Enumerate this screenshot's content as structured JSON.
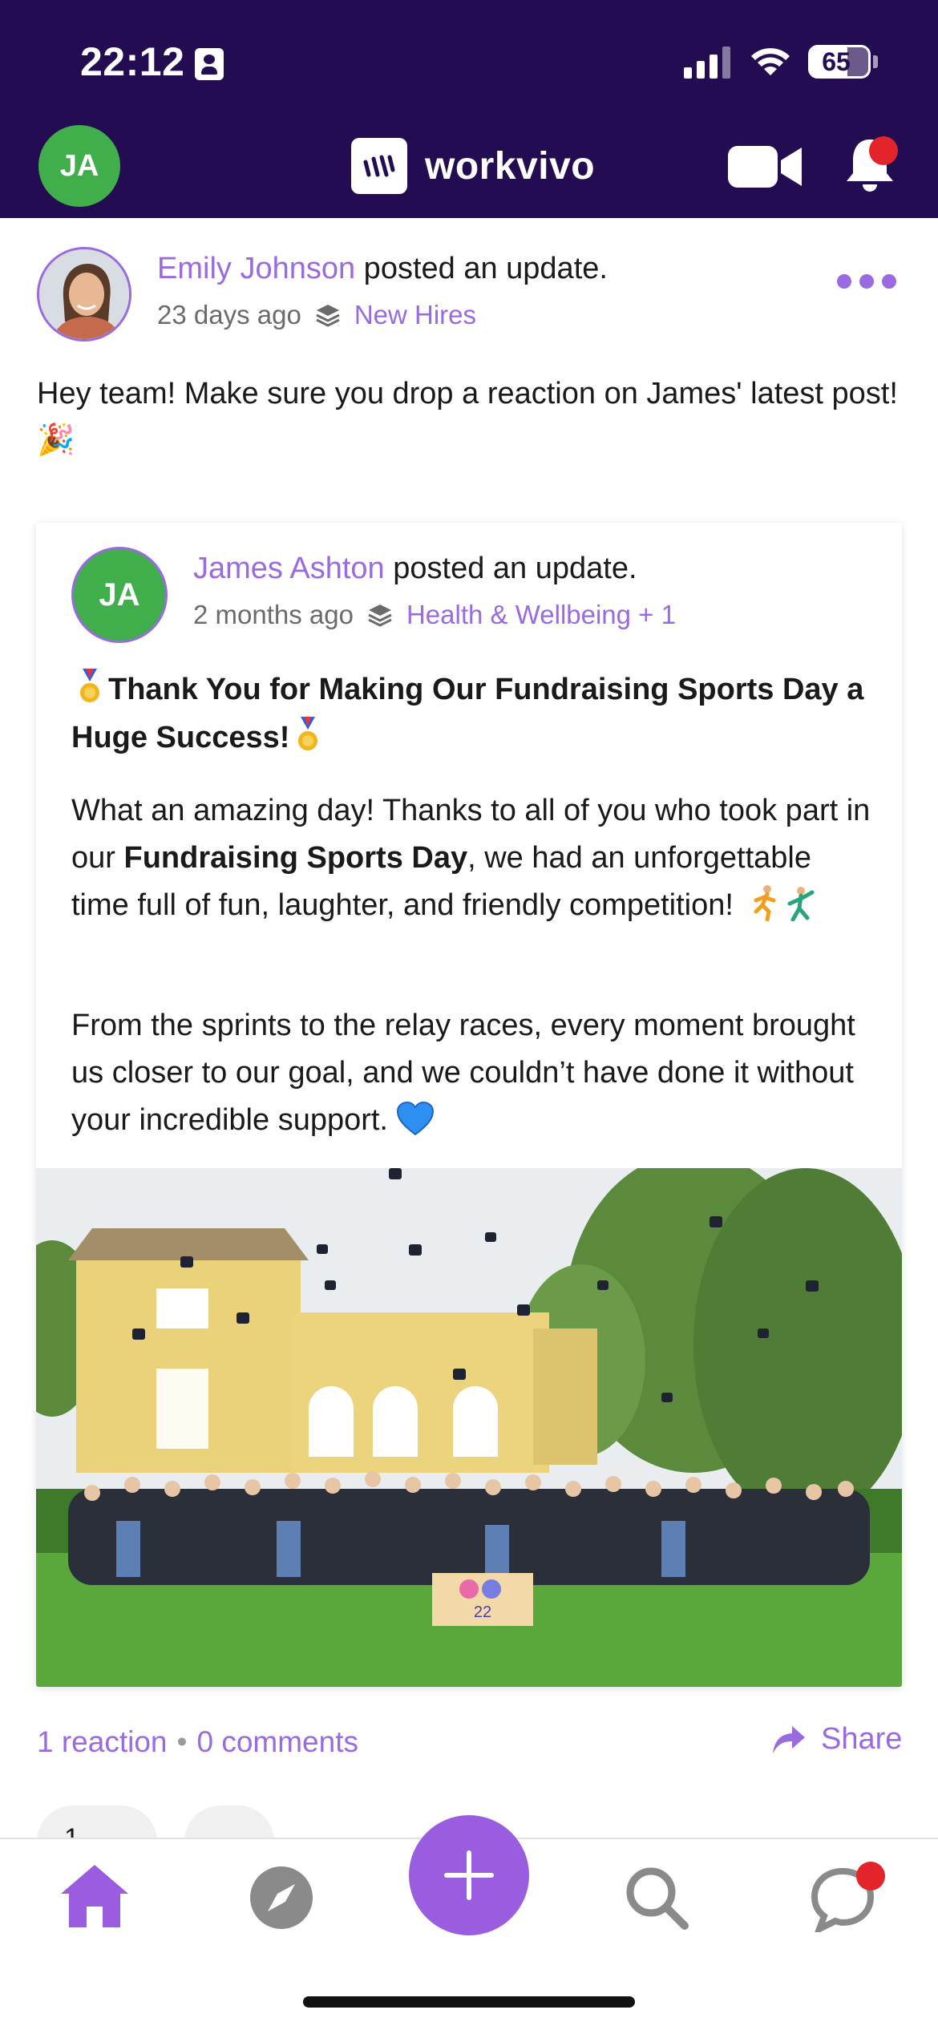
{
  "status_bar": {
    "time": "22:12",
    "battery": "65"
  },
  "header": {
    "user_initials": "JA",
    "brand_name": "workvivo",
    "icons": [
      "video-icon",
      "bell-icon"
    ]
  },
  "post": {
    "author": "Emily Johnson",
    "action": " posted an update.",
    "time_ago": "23 days ago",
    "group": "New Hires",
    "text": "Hey team! Make sure you drop a reaction on James' latest post! 🎉"
  },
  "shared_post": {
    "avatar_initials": "JA",
    "author": "James Ashton",
    "action": " posted an update.",
    "time_ago": "2 months ago",
    "group": "Health & Wellbeing + 1",
    "title": "Thank You for Making Our Fundraising Sports Day a Huge Success!",
    "para1_a": "What an amazing day! Thanks to all of you who took part in our ",
    "para1_bold": "Fundraising Sports Day",
    "para1_b": ", we had an unforgettable time full of fun, laughter, and friendly competition!",
    "para2": "From the sprints to the relay races, every moment brought us closer to our goal, and we couldn’t have done it without your incredible support.",
    "photo_banner": "22"
  },
  "footer": {
    "reactions": "1 reaction",
    "separator": "•",
    "comments": "0 comments",
    "share": "Share",
    "reaction_count": "1"
  },
  "nav": {
    "items": [
      "home-icon",
      "compass-icon",
      "plus-icon",
      "search-icon",
      "chat-icon"
    ]
  },
  "colors": {
    "header_bg": "#240c52",
    "accent": "#9a6ae0",
    "avatar_green": "#3fae4b",
    "notification_red": "#e3242b"
  }
}
